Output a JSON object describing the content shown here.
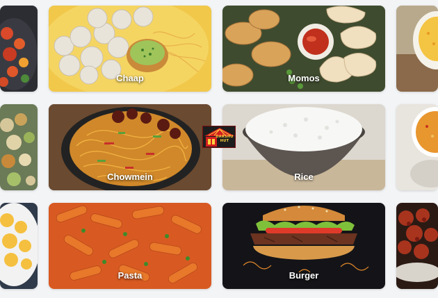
{
  "grid": {
    "items": [
      {
        "id": "left-top",
        "label": ""
      },
      {
        "id": "chaap",
        "label": "Chaap"
      },
      {
        "id": "momos",
        "label": "Momos"
      },
      {
        "id": "right-top",
        "label": ""
      },
      {
        "id": "left-mid",
        "label": ""
      },
      {
        "id": "chowmein",
        "label": "Chowmein"
      },
      {
        "id": "rice",
        "label": "Rice"
      },
      {
        "id": "right-mid",
        "label": ""
      },
      {
        "id": "left-bottom",
        "label": ""
      },
      {
        "id": "pasta",
        "label": "Pasta"
      },
      {
        "id": "burger",
        "label": "Burger"
      },
      {
        "id": "right-bottom",
        "label": ""
      }
    ]
  },
  "logo": {
    "text": "DARSHU HUT",
    "icon": "restaurant-hut-logo"
  },
  "colors": {
    "page_bg": "#f3f4f6",
    "label_text": "#ffffff"
  }
}
